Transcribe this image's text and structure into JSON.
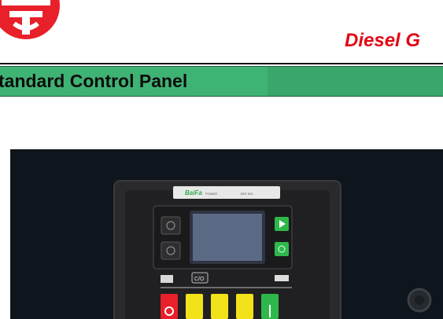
{
  "header": {
    "headline": "Diesel G"
  },
  "banner": {
    "title": "tandard Control Panel"
  },
  "controller": {
    "brand": "BaiFa",
    "brand_sub": "POWER",
    "model": "BFK 620",
    "co_button": "C/O",
    "colors": {
      "stop": "#e8202a",
      "yellow": "#f2e21a",
      "green": "#2fb84a",
      "lcd": "#5a6a84"
    }
  },
  "colors": {
    "headline": "#e30613",
    "banner": "#3fb374",
    "logo": "#e8202a"
  }
}
